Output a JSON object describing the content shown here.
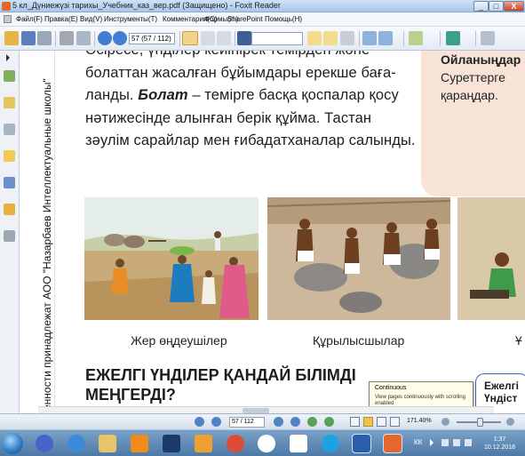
{
  "window": {
    "title": "5 кл_Дүниежүзі тарихы_Учебник_каз_вер.pdf (Защищено) - Foxit Reader",
    "min_label": "_",
    "max_label": "□",
    "close_label": "X"
  },
  "menu": [
    "Файл(F)",
    "Правка(E)",
    "Вид(V)",
    "Инструменты(T)",
    "Комментарии(C)",
    "Формы(m)",
    "SharePoint",
    "Помощь(H)"
  ],
  "toolbar": {
    "page_input": "57 (57 / 112)",
    "icons": [
      "open-icon",
      "save-icon",
      "print-icon",
      "nav-back-icon",
      "nav-forward-icon",
      "hand-icon",
      "select-text-icon",
      "find-icon",
      "fit-page-icon",
      "rotate-icon",
      "typewriter-icon",
      "tools-icon"
    ]
  },
  "sidebar": {
    "icons": [
      "pages-icon",
      "bookmarks-icon",
      "attachments-icon",
      "comments-icon",
      "security-icon",
      "layers-icon",
      "signature-icon"
    ]
  },
  "document": {
    "spine_text": "ённости принадлежат АОО \"Назарбаев Интеллектуальные школы\"",
    "para_lines": [
      "Әсіресе, үнділер кейінірек темірден және",
      "болаттан жасалған бұйымдары ерекше баға-",
      "ланды. ",
      " – темірге басқа қоспалар қосу",
      "нәтижесінде алынған берік құйма. Тастан",
      "зәулім сарайлар мен ғибадатханалар салынды."
    ],
    "para_term": "Болат",
    "think_title": "Ойланыңдар",
    "think_text": "Суреттерге қараңдар.",
    "captions": [
      "Жер өңдеушілер",
      "Құрылысшылар",
      "Ұ"
    ],
    "heading_line1": "ЕЖЕЛГІ ҮНДІЛЕР ҚАНДАЙ БІЛІМДІ",
    "heading_line2": "МЕҢГЕРДІ?",
    "side_box": "Ежелгі Үндіст"
  },
  "tooltip": {
    "title": "Continuous",
    "description": "View pages continuously with scrolling enabled"
  },
  "statusbar": {
    "page": "57 / 112",
    "zoom": "171.40%"
  },
  "taskbar": {
    "apps": [
      "windows-start",
      "microphone-icon",
      "internet-explorer-icon",
      "explorer-folder-icon",
      "vlc-icon",
      "photoshop-icon",
      "media-player-icon",
      "chrome-icon",
      "yandex-icon",
      "yandex-browser-icon",
      "mail-icon",
      "word-icon",
      "foxit-pdf-icon"
    ],
    "lang": "КК",
    "time": "1:37",
    "date": "10.12.2018"
  },
  "colors": {
    "title_bar": "#a9c7ea",
    "think_box": "#f7e4d6",
    "side_box_border": "#3b6bb3",
    "taskbar": "#4d79a6"
  }
}
